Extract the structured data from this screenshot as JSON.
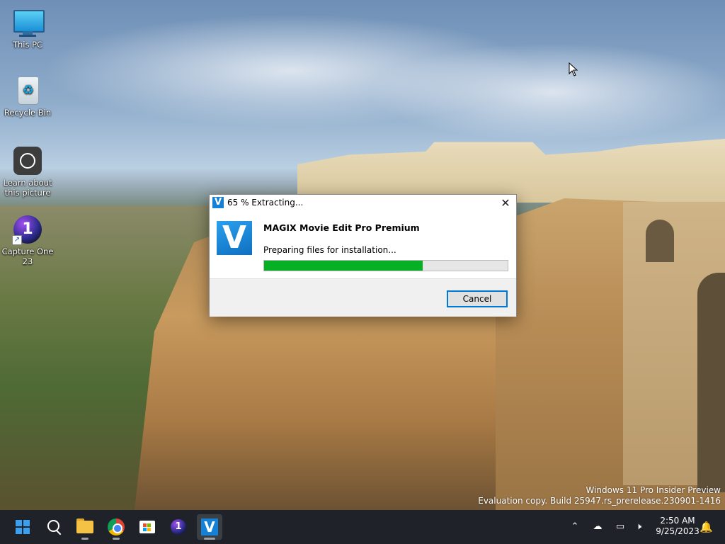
{
  "desktop": {
    "icons": [
      {
        "label": "This PC",
        "icon": "monitor-icon"
      },
      {
        "label": "Recycle Bin",
        "icon": "recycle-bin-icon"
      },
      {
        "label": "Learn about this picture",
        "icon": "learn-picture-icon"
      },
      {
        "label": "Capture One 23",
        "icon": "capture-one-icon"
      }
    ],
    "recycle_glyph": "♻",
    "capture_one_glyph": "1",
    "shortcut_glyph": "↗"
  },
  "dialog": {
    "title": "65 % Extracting...",
    "logo_glyph": "V",
    "close_glyph": "✕",
    "product_name": "MAGIX Movie Edit Pro Premium",
    "status": "Preparing files for installation...",
    "progress_percent": 65,
    "progress_color": "#06b025",
    "cancel_label": "Cancel"
  },
  "watermark": {
    "line1": "Windows 11 Pro Insider Preview",
    "line2": "Evaluation copy. Build 25947.rs_prerelease.230901-1416"
  },
  "taskbar": {
    "apps": [
      {
        "name": "start-button",
        "icon": "windows-logo-icon"
      },
      {
        "name": "search-button",
        "icon": "search-icon"
      },
      {
        "name": "file-explorer-button",
        "icon": "folder-icon"
      },
      {
        "name": "chrome-button",
        "icon": "chrome-icon"
      },
      {
        "name": "store-button",
        "icon": "microsoft-store-icon"
      },
      {
        "name": "capture-one-button",
        "icon": "capture-one-icon"
      },
      {
        "name": "magix-button",
        "icon": "magix-v-icon",
        "active": true
      }
    ],
    "tray": {
      "chevron_glyph": "⌃",
      "network_glyph": "☁",
      "display_glyph": "▭",
      "volume_glyph": "🕨",
      "bell_glyph": "🔔"
    },
    "clock": {
      "time": "2:50 AM",
      "date": "9/25/2023"
    }
  },
  "colors": {
    "taskbar_bg": "#1f2329",
    "accent": "#0078d7",
    "magix_blue": "#1581d6"
  }
}
